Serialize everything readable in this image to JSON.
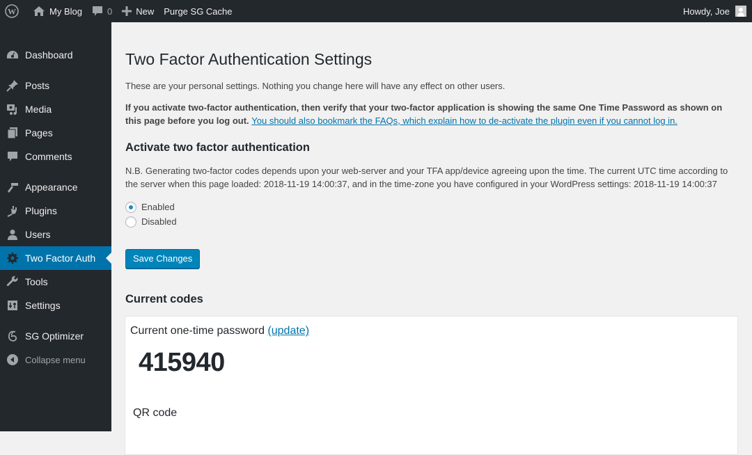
{
  "adminbar": {
    "site_name": "My Blog",
    "comments_count": "0",
    "new_label": "New",
    "purge_label": "Purge SG Cache",
    "greeting": "Howdy, Joe"
  },
  "sidebar": {
    "items": [
      {
        "label": "Dashboard",
        "icon": "dashboard-icon"
      },
      {
        "label": "Posts",
        "icon": "pin-icon"
      },
      {
        "label": "Media",
        "icon": "media-icon"
      },
      {
        "label": "Pages",
        "icon": "pages-icon"
      },
      {
        "label": "Comments",
        "icon": "comment-icon"
      },
      {
        "label": "Appearance",
        "icon": "brush-icon"
      },
      {
        "label": "Plugins",
        "icon": "plug-icon"
      },
      {
        "label": "Users",
        "icon": "user-icon"
      },
      {
        "label": "Two Factor Auth",
        "icon": "gear-icon",
        "active": true
      },
      {
        "label": "Tools",
        "icon": "wrench-icon"
      },
      {
        "label": "Settings",
        "icon": "sliders-icon"
      },
      {
        "label": "SG Optimizer",
        "icon": "sg-icon"
      },
      {
        "label": "Collapse menu",
        "icon": "collapse-arrow-icon"
      }
    ]
  },
  "main": {
    "title": "Two Factor Authentication Settings",
    "intro": "These are your personal settings. Nothing you change here will have any effect on other users.",
    "warning": "If you activate two-factor authentication, then verify that your two-factor application is showing the same One Time Password as shown on this page before you log out.",
    "faq_link": "You should also bookmark the FAQs, which explain how to de-activate the plugin even if you cannot log in.",
    "activate_heading": "Activate two factor authentication",
    "nb_text": "N.B. Generating two-factor codes depends upon your web-server and your TFA app/device agreeing upon the time. The current UTC time according to the server when this page loaded: 2018-11-19 14:00:37, and in the time-zone you have configured in your WordPress settings: 2018-11-19 14:00:37",
    "radio_enabled": "Enabled",
    "radio_disabled": "Disabled",
    "selected": "Enabled",
    "save_label": "Save Changes",
    "codes_heading": "Current codes",
    "otp_label": "Current one-time password",
    "update_link": "(update)",
    "otp_value": "415940",
    "qr_label": "QR code"
  },
  "colors": {
    "accent": "#0073aa",
    "button": "#0085ba",
    "sidebar_bg": "#23282d"
  }
}
